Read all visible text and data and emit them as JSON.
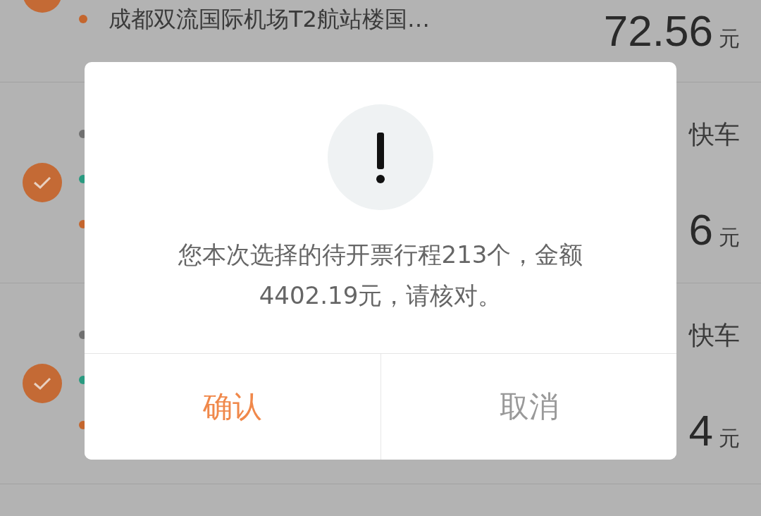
{
  "trips": [
    {
      "checked": true,
      "stops": [
        {
          "color": "#c4662e",
          "text": "成都双流国际机场T2航站楼国…"
        }
      ],
      "amount": "72.56",
      "unit": "元"
    },
    {
      "checked": true,
      "stops": [
        {
          "color": "#707070"
        },
        {
          "color": "#2a9a80"
        },
        {
          "color": "#c4662e"
        }
      ],
      "tag": "快车",
      "amount": "6",
      "unit": "元"
    },
    {
      "checked": true,
      "stops": [
        {
          "color": "#707070"
        },
        {
          "color": "#2a9a80"
        },
        {
          "color": "#c4662e"
        }
      ],
      "tag": "快车",
      "amount": "4",
      "unit": "元"
    }
  ],
  "dialog": {
    "message_lines": [
      "您本次选择的待开票行程213个，金额",
      "4402.19元，请核对。"
    ],
    "buttons": [
      {
        "label": "确认",
        "kind": "primary"
      },
      {
        "label": "取消",
        "kind": "secondary"
      }
    ]
  }
}
